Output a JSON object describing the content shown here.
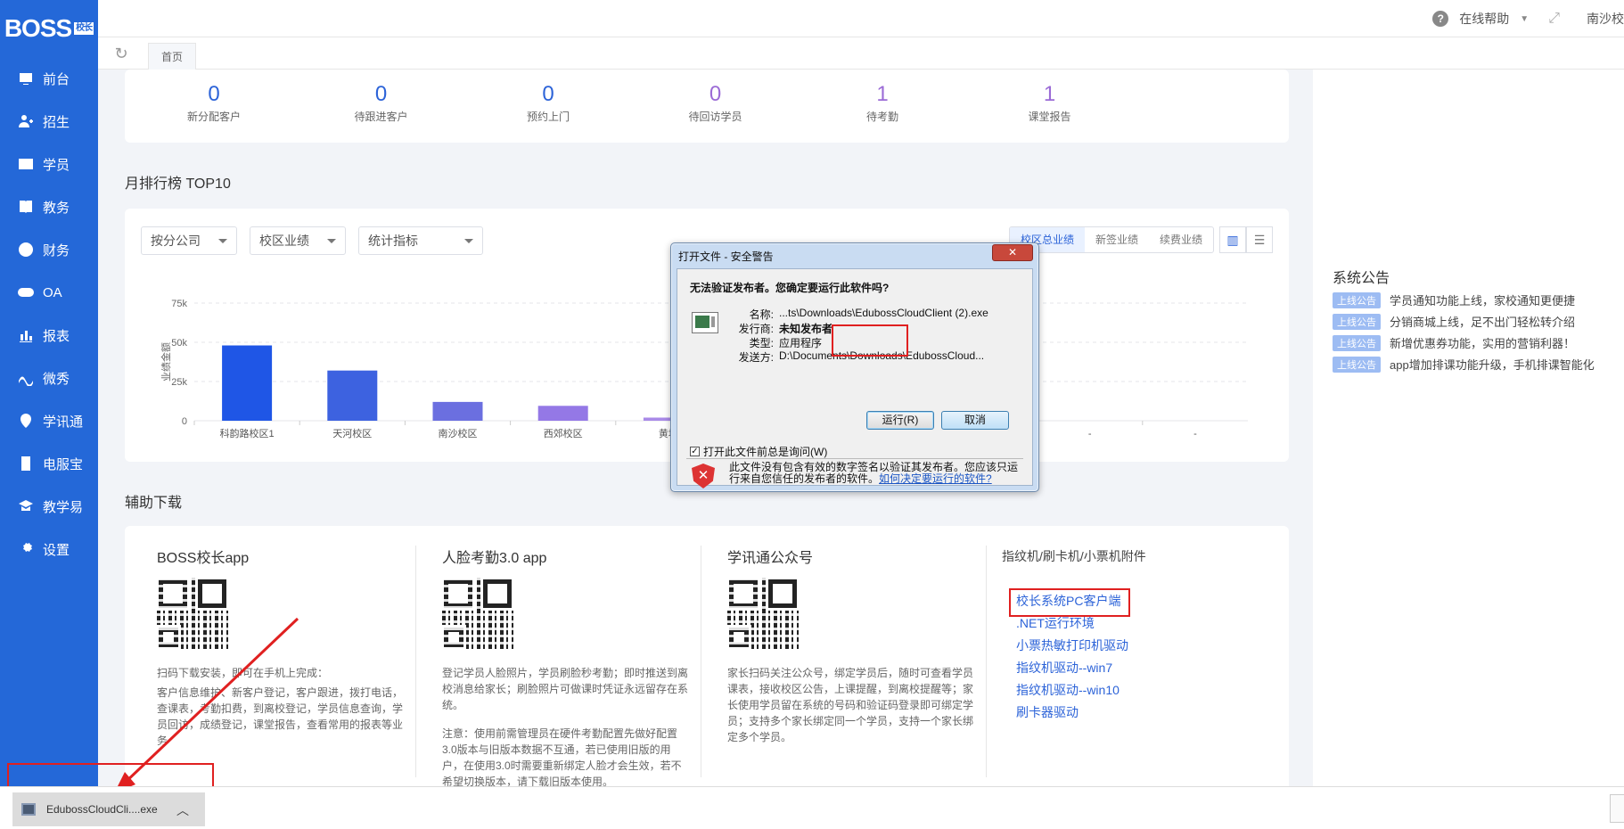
{
  "brand": {
    "logo": "BOSS",
    "logo_badge": "校长"
  },
  "sidebar": {
    "items": [
      {
        "label": "前台",
        "icon": "monitor-icon"
      },
      {
        "label": "招生",
        "icon": "user-add-icon"
      },
      {
        "label": "学员",
        "icon": "id-card-icon"
      },
      {
        "label": "教务",
        "icon": "book-icon"
      },
      {
        "label": "财务",
        "icon": "yen-icon"
      },
      {
        "label": "OA",
        "icon": "toggle-icon"
      },
      {
        "label": "报表",
        "icon": "bar-chart-icon"
      },
      {
        "label": "微秀",
        "icon": "wave-icon"
      },
      {
        "label": "学讯通",
        "icon": "location-icon"
      },
      {
        "label": "电服宝",
        "icon": "phone-icon"
      },
      {
        "label": "教学易",
        "icon": "teach-icon"
      },
      {
        "label": "设置",
        "icon": "gear-icon"
      }
    ]
  },
  "topbar": {
    "help": "在线帮助",
    "user": "南沙校"
  },
  "tabs": {
    "home": "首页"
  },
  "stats": [
    {
      "value": "0",
      "label": "新分配客户",
      "color": "#2c63d8"
    },
    {
      "value": "0",
      "label": "待跟进客户",
      "color": "#2c63d8"
    },
    {
      "value": "0",
      "label": "预约上门",
      "color": "#2c63d8"
    },
    {
      "value": "0",
      "label": "待回访学员",
      "color": "#9b6bd6"
    },
    {
      "value": "1",
      "label": "待考勤",
      "color": "#9b6bd6"
    },
    {
      "value": "1",
      "label": "课堂报告",
      "color": "#9b6bd6"
    }
  ],
  "ranking": {
    "title": "月排行榜 TOP10",
    "filters": [
      "按分公司",
      "校区业绩",
      "统计指标"
    ],
    "segments": [
      "校区总业绩",
      "新签业绩",
      "续费业绩"
    ],
    "view_bar": "▥",
    "view_list": "☰"
  },
  "chart_data": {
    "type": "bar",
    "ylabel": "业绩金额",
    "ylim": [
      0,
      75000
    ],
    "yticks": [
      "0",
      "25k",
      "50k",
      "75k"
    ],
    "categories": [
      "科韵路校区1",
      "天河校区",
      "南沙校区",
      "西郊校区",
      "黄埔",
      "-",
      "-",
      "-",
      "-",
      "-"
    ],
    "values": [
      48000,
      32000,
      12000,
      9500,
      2000,
      0,
      0,
      0,
      0,
      0
    ],
    "colors": [
      "#1f56e6",
      "#3d62e0",
      "#6b6fe0",
      "#9478e6",
      "#a98ae8",
      "#ccc",
      "#ccc",
      "#ccc",
      "#ccc",
      "#ccc"
    ]
  },
  "downloads": {
    "title": "辅助下载",
    "cols": [
      {
        "title": "BOSS校长app",
        "p1": "扫码下载安装，即可在手机上完成：",
        "p2": "客户信息维护、新客户登记，客户跟进，拨打电话，查课表，考勤扣费，到离校登记，学员信息查询，学员回访，成绩登记，课堂报告，查看常用的报表等业务"
      },
      {
        "title": "人脸考勤3.0 app",
        "p1": "登记学员人脸照片，学员刷脸秒考勤；即时推送到离校消息给家长；刷脸照片可做课时凭证永远留存在系统。",
        "p2": "注意：使用前需管理员在硬件考勤配置先做好配置3.0版本与旧版本数据不互通，若已使用旧版的用户，在使用3.0时需要重新绑定人脸才会生效，若不希望切换版本，请下载旧版本使用。"
      },
      {
        "title": "学讯通公众号",
        "p1": "家长扫码关注公众号，绑定学员后，随时可查看学员课表，接收校区公告，上课提醒，到离校提醒等；家长使用学员留在系统的号码和验证码登录即可绑定学员；支持多个家长绑定同一个学员，支持一个家长绑定多个学员。"
      }
    ],
    "attach_title": "指纹机/刷卡机/小票机附件",
    "links": [
      "校长系统PC客户端",
      ".NET运行环境",
      "小票热敏打印机驱动",
      "指纹机驱动--win7",
      "指纹机驱动--win10",
      "刷卡器驱动"
    ]
  },
  "notices": {
    "title": "系统公告",
    "tag": "上线公告",
    "items": [
      "学员通知功能上线，家校通知更便捷",
      "分销商城上线，足不出门轻松转介绍",
      "新增优惠券功能，实用的营销利器！",
      "app增加排课功能升级，手机排课智能化"
    ]
  },
  "dialog": {
    "title": "打开文件 - 安全警告",
    "close": "✕",
    "question": "无法验证发布者。您确定要运行此软件吗?",
    "fields": [
      {
        "k": "名称:",
        "v": "...ts\\Downloads\\EdubossCloudClient (2).exe",
        "bold": false
      },
      {
        "k": "发行商:",
        "v": "未知发布者",
        "bold": true
      },
      {
        "k": "类型:",
        "v": "应用程序",
        "bold": false
      },
      {
        "k": "发送方:",
        "v": "D:\\Documents\\Downloads\\EdubossCloud...",
        "bold": false
      }
    ],
    "run": "运行(R)",
    "cancel": "取消",
    "checkbox": "打开此文件前总是询问(W)",
    "warning": "此文件没有包含有效的数字签名以验证其发布者。您应该只运行来自您信任的发布者的软件。",
    "warning_link": "如何决定要运行的软件?"
  },
  "download_bar": {
    "file": "EdubossCloudCli....exe",
    "chevron": "︿"
  }
}
